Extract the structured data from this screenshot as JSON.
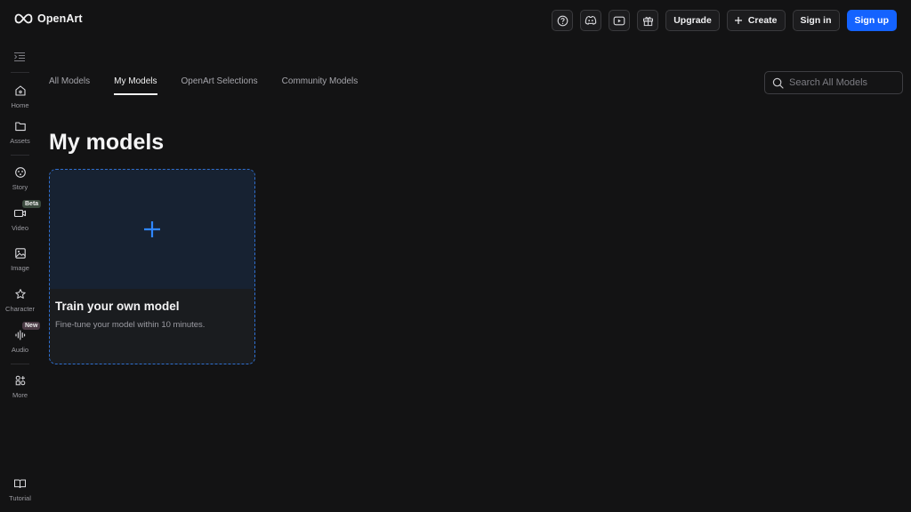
{
  "app": {
    "name": "OpenArt"
  },
  "header": {
    "icons": [
      "help-icon",
      "discord-icon",
      "youtube-icon",
      "gift-icon"
    ],
    "upgrade_label": "Upgrade",
    "create_label": "Create",
    "signin_label": "Sign in",
    "signup_label": "Sign up"
  },
  "sidebar": {
    "items": [
      {
        "label": "Home",
        "icon": "home-icon"
      },
      {
        "label": "Assets",
        "icon": "folder-icon"
      },
      {
        "label": "Story",
        "icon": "story-icon",
        "badge": "Beta"
      },
      {
        "label": "Video",
        "icon": "video-icon"
      },
      {
        "label": "Image",
        "icon": "image-icon"
      },
      {
        "label": "Character",
        "icon": "character-icon",
        "badge": "New"
      },
      {
        "label": "Audio",
        "icon": "audio-icon"
      },
      {
        "label": "More",
        "icon": "more-icon"
      },
      {
        "label": "Tutorial",
        "icon": "book-icon"
      }
    ]
  },
  "tabs": [
    {
      "label": "All Models",
      "active": false
    },
    {
      "label": "My Models",
      "active": true
    },
    {
      "label": "OpenArt Selections",
      "active": false
    },
    {
      "label": "Community Models",
      "active": false
    }
  ],
  "search": {
    "placeholder": "Search All Models",
    "value": ""
  },
  "main": {
    "title": "My models",
    "card": {
      "title": "Train your own model",
      "description": "Fine-tune your model within 10 minutes."
    }
  },
  "colors": {
    "background": "#131314",
    "primary": "#1463ff",
    "card_border": "#2f6fcf",
    "plus": "#2f86ff"
  }
}
